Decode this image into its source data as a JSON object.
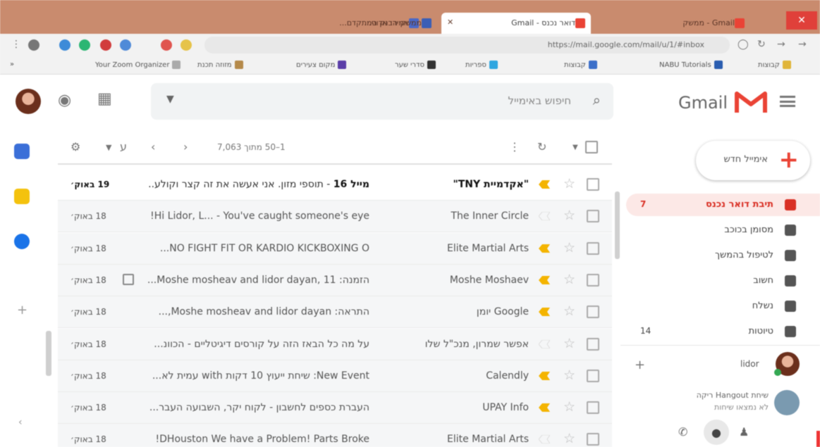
{
  "browser": {
    "tabs": [
      {
        "title": "אמירו אדוני...",
        "active": false
      },
      {
        "title": "ממשק הבנק המתקדם...",
        "active": false
      },
      {
        "title": "דואר נכנס - Gmail",
        "active": true
      },
      {
        "title": "Gmail - ממשק",
        "active": false
      }
    ],
    "close_glyph": "✕",
    "url": "https://mail.google.com/mail/u/1/#inbox"
  },
  "bookmarks": [
    "Your Zoom Organizer",
    "מזוזה תכנת",
    "מקום צעירים",
    "סדרי שער",
    "ספריות",
    "קבוצות",
    "NABU Tutorials",
    "קבוצות"
  ],
  "header": {
    "search_placeholder": "חיפוש באימייל",
    "brand": "Gmail"
  },
  "compose": {
    "label": "אימייל חדש"
  },
  "nav": [
    {
      "label": "תיבת דואר נכנס",
      "count": "7",
      "active": true
    },
    {
      "label": "מסומן בכוכב",
      "count": ""
    },
    {
      "label": "לטיפול בהמשך",
      "count": ""
    },
    {
      "label": "חשוב",
      "count": ""
    },
    {
      "label": "נשלח",
      "count": ""
    },
    {
      "label": "טיוטות",
      "count": "14"
    }
  ],
  "hangouts": {
    "user": "lidor",
    "invite_title": "שיחת Hangout ריקה",
    "invite_sub": "לא נמצאו שיחות"
  },
  "list": {
    "pager": "1–50 מתוך 7,063"
  },
  "emails": [
    {
      "sender": "\"אקדמיית TNY\"",
      "subject": "מייל 16",
      "snippet": " - תוספי מזון. אני אעשה את זה קצר וקולע..",
      "date": "19 באוק׳",
      "unread": true,
      "important": true,
      "calendar": false
    },
    {
      "sender": "The Inner Circle",
      "subject": "",
      "snippet": "Hi Lidor, L... - You've caught someone's eye!",
      "date": "18 באוק׳",
      "unread": false,
      "important": false,
      "calendar": false
    },
    {
      "sender": "Elite Martial Arts",
      "subject": "",
      "snippet": "NO FIGHT FIT OR KARDIO KICKBOXING O...",
      "date": "18 באוק׳",
      "unread": false,
      "important": true,
      "calendar": false
    },
    {
      "sender": "Moshe Moshaev",
      "subject": "",
      "snippet": "הזמנה: Moshe mosheav and lidor dayan, 11...",
      "date": "18 באוק׳",
      "unread": false,
      "important": true,
      "calendar": true
    },
    {
      "sender": "Google יומן",
      "subject": "",
      "snippet": "התראה: Moshe mosheav and lidor dayan,...",
      "date": "18 באוק׳",
      "unread": false,
      "important": true,
      "calendar": false
    },
    {
      "sender": "אפשר שמרון, מנכ\"ל שלו",
      "subject": "",
      "snippet": "על מה כל הבאז הזה על קורסים דיגיטליים - הכוונ...",
      "date": "18 באוק׳",
      "unread": false,
      "important": false,
      "calendar": false
    },
    {
      "sender": "Calendly",
      "subject": "",
      "snippet": "New Event: שיחת ייעוץ 10 דקות with עמית לא...",
      "date": "18 באוק׳",
      "unread": false,
      "important": true,
      "calendar": false
    },
    {
      "sender": "UPAY Info",
      "subject": "",
      "snippet": "העברת כספים לחשבון - לקוח יקר, השבועה העבר...",
      "date": "18 באוק׳",
      "unread": false,
      "important": true,
      "calendar": false
    },
    {
      "sender": "Elite Martial Arts",
      "subject": "",
      "snippet": "DHouston We have a Problem! Parts Broke!",
      "date": "18 באוק׳",
      "unread": false,
      "important": false,
      "calendar": false
    }
  ],
  "colors": {
    "tabstrip": "#c98b6e",
    "gmail_red": "#ea4335",
    "important": "#f4b400",
    "active_nav": "#fce8e6"
  }
}
